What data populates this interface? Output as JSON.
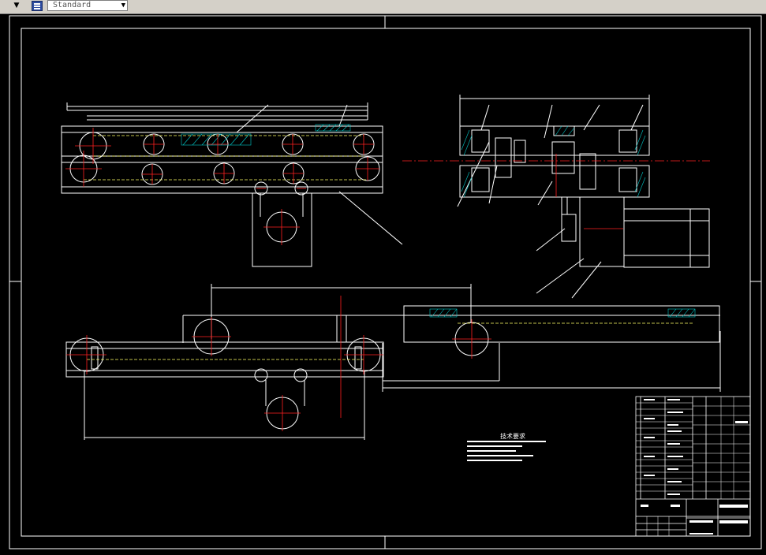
{
  "toolbar": {
    "dropdown_arrow": "▼",
    "style_icon": "text-style-icon",
    "style_value": "Standard",
    "style_arrow": "▼"
  },
  "drawing": {
    "technical_requirements_title": "技术要求",
    "colors": {
      "background": "#000000",
      "lines": "#ffffff",
      "centerlines": "#ff0000",
      "chain": "#ffff66",
      "hatch": "#00c8c8",
      "toolbar": "#d4d0c8"
    }
  }
}
